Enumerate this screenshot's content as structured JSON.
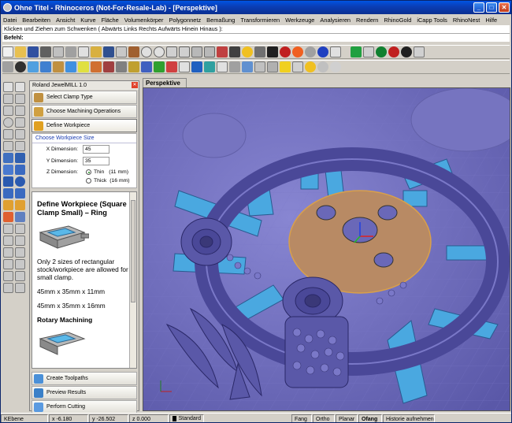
{
  "window": {
    "title": "Ohne Titel - Rhinoceros (Not-For-Resale-Lab) - [Perspektive]",
    "min": "_",
    "max": "□",
    "close": "✕"
  },
  "menu": [
    "Datei",
    "Bearbeiten",
    "Ansicht",
    "Kurve",
    "Fläche",
    "Volumenkörper",
    "Polygonnetz",
    "Bemaßung",
    "Transformieren",
    "Werkzeuge",
    "Analysieren",
    "Rendern",
    "RhinoGold",
    "iCapp Tools",
    "RhinoNest",
    "Hilfe"
  ],
  "command": {
    "history": "Klicken und Ziehen zum Schwenken ( Abwärts  Links  Rechts  Aufwärts  Hinein  Hinaus ):",
    "prompt": "Befehl:",
    "value": ""
  },
  "panel": {
    "title": "Roland JewelMILL 1.0",
    "close": "✕",
    "steps": [
      "Select Clamp Type",
      "Choose Machining Operations",
      "Define Workpiece"
    ],
    "size_group": {
      "title": "Choose Workpiece Size",
      "x_label": "X Dimension:",
      "x_value": "45",
      "y_label": "Y Dimension:",
      "y_value": "35",
      "z_label": "Z Dimension:",
      "z_options": [
        {
          "label": "Thin",
          "extra": "(11 mm)",
          "selected": true
        },
        {
          "label": "Thick",
          "extra": "(16 mm)",
          "selected": false
        }
      ]
    },
    "help": {
      "title": "Define Workpiece (Square Clamp Small) – Ring",
      "p1": "Only 2 sizes of rectangular stock/workpiece are allowed for small clamp.",
      "p2": "45mm x 35mm x 11mm",
      "p3": "45mm x 35mm x 16mm",
      "sub": "Rotary Machining"
    },
    "actions": [
      "Create Toolpaths",
      "Preview Results",
      "Perform Cutting"
    ]
  },
  "viewport": {
    "tab": "Perspektive"
  },
  "status": {
    "cplane": "KEbene",
    "x": "x -6.180",
    "y": "y -26.502",
    "z": "z 0.000",
    "layer": "Standard",
    "layer_color": "#000000",
    "snap": "Fang",
    "ortho": "Ortho",
    "planar": "Planar",
    "osnap": "Ofang",
    "history": "Historie aufnehmen"
  },
  "colors": {
    "titlebar": "#0a3fb8",
    "viewport_bg": "#6a68b8",
    "model": "#5a5aa8",
    "stone": "#4aa8e0",
    "workpiece": "#b88a64"
  }
}
